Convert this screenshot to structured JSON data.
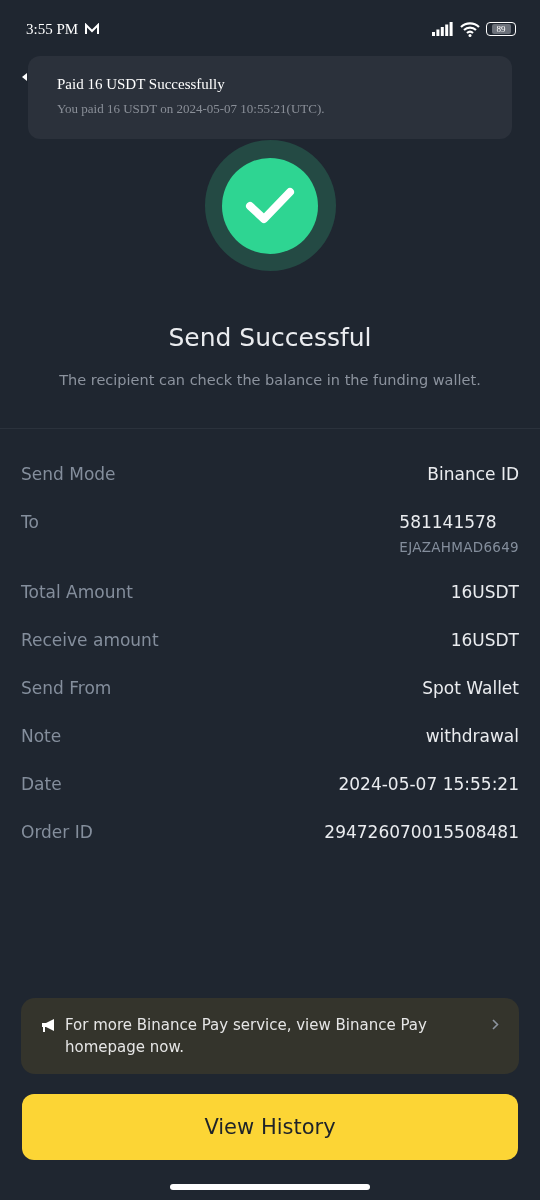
{
  "status_bar": {
    "time": "3:55 PM",
    "battery": "89"
  },
  "notification": {
    "title": "Paid 16 USDT Successfully",
    "message": "You paid 16 USDT on 2024-05-07 10:55:21(UTC)."
  },
  "result": {
    "title": "Send Successful",
    "subtitle": "The recipient can check the balance in the funding wallet."
  },
  "details": [
    {
      "label": "Send Mode",
      "value": "Binance ID"
    },
    {
      "label": "To",
      "value": "581141578",
      "sub_value": "EJAZAHMAD6649"
    },
    {
      "label": "Total Amount",
      "value": "16USDT"
    },
    {
      "label": "Receive amount",
      "value": "16USDT"
    },
    {
      "label": "Send From",
      "value": "Spot Wallet"
    },
    {
      "label": "Note",
      "value": "withdrawal"
    },
    {
      "label": "Date",
      "value": "2024-05-07 15:55:21"
    },
    {
      "label": "Order ID",
      "value": "294726070015508481"
    }
  ],
  "banner": {
    "text": "For more Binance Pay service, view Binance Pay homepage now."
  },
  "button": {
    "label": "View History"
  }
}
